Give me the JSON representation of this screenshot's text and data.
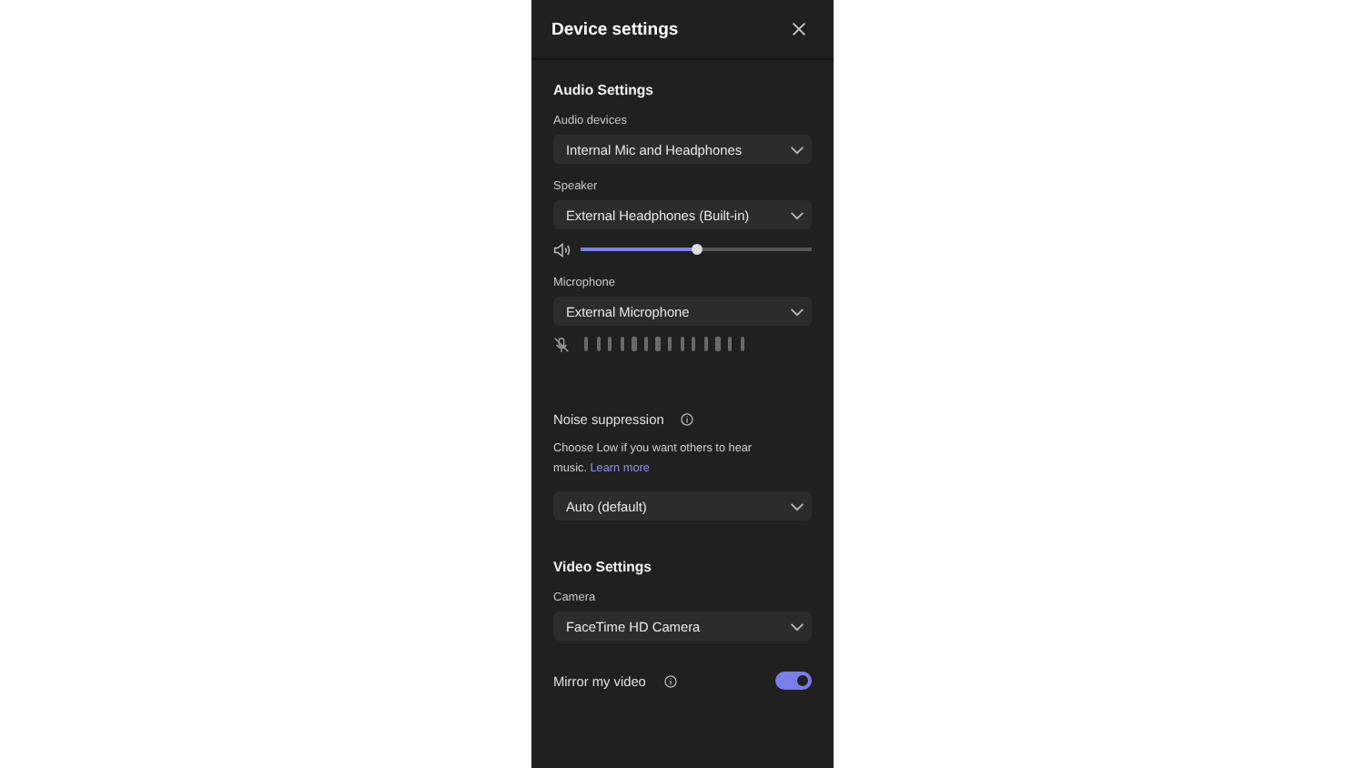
{
  "panel": {
    "title": "Device settings"
  },
  "audio": {
    "heading": "Audio Settings",
    "audio_devices": {
      "label": "Audio devices",
      "value": "Internal Mic and Headphones"
    },
    "speaker": {
      "label": "Speaker",
      "value": "External Headphones (Built-in)",
      "volume": {
        "level": 0.5
      }
    },
    "microphone": {
      "label": "Microphone",
      "value": "External Microphone",
      "muted": true
    },
    "noise_suppression": {
      "label": "Noise suppression",
      "description": "Choose Low if you want others to hear music.",
      "link": "Learn more",
      "value": "Auto (default)"
    }
  },
  "video": {
    "heading": "Video Settings",
    "camera": {
      "label": "Camera",
      "value": "FaceTime HD Camera"
    },
    "mirror": {
      "label": "Mirror my video",
      "on": true
    }
  }
}
